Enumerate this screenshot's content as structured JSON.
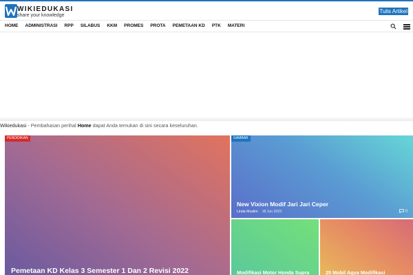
{
  "header": {
    "logo_title": "WIKIEDUKASI",
    "logo_tagline": "share your knowledge",
    "write_button": "Tulis Artikel"
  },
  "nav": {
    "items": [
      "HOME",
      "ADMINISTRASI",
      "RPP",
      "SILABUS",
      "KKM",
      "PROMES",
      "PROTA",
      "PEMETAAN KD",
      "PTK",
      "MATERI"
    ]
  },
  "intro": {
    "brand": "Wikiedukasi",
    "prefix": " - Pembahasan perihal ",
    "highlight": "Home",
    "suffix": " dapat Anda temukan di sini secara keseluruhan."
  },
  "featured": {
    "main": {
      "category": "PENDIDIKAN",
      "title": "Pemetaan KD Kelas 3 Semester 1 Dan 2 Revisi 2022"
    },
    "top_right": {
      "category": "GAMBAR",
      "title": "New Vixion Modif Jari Jari Ceper",
      "author": "Linda Muslim",
      "date": "18 Jun 2023",
      "comments": "0"
    },
    "bottom_left": {
      "title": "Modifikasi Motor Honda Supra"
    },
    "bottom_right": {
      "title": "25 Mobil Agya Modifikasi"
    }
  },
  "colors": {
    "accent": "#1e73be",
    "badge_red": "#d62a2a"
  },
  "icons": [
    "wikiedukasi-logo-icon",
    "search-icon",
    "menu-icon",
    "comment-icon"
  ]
}
